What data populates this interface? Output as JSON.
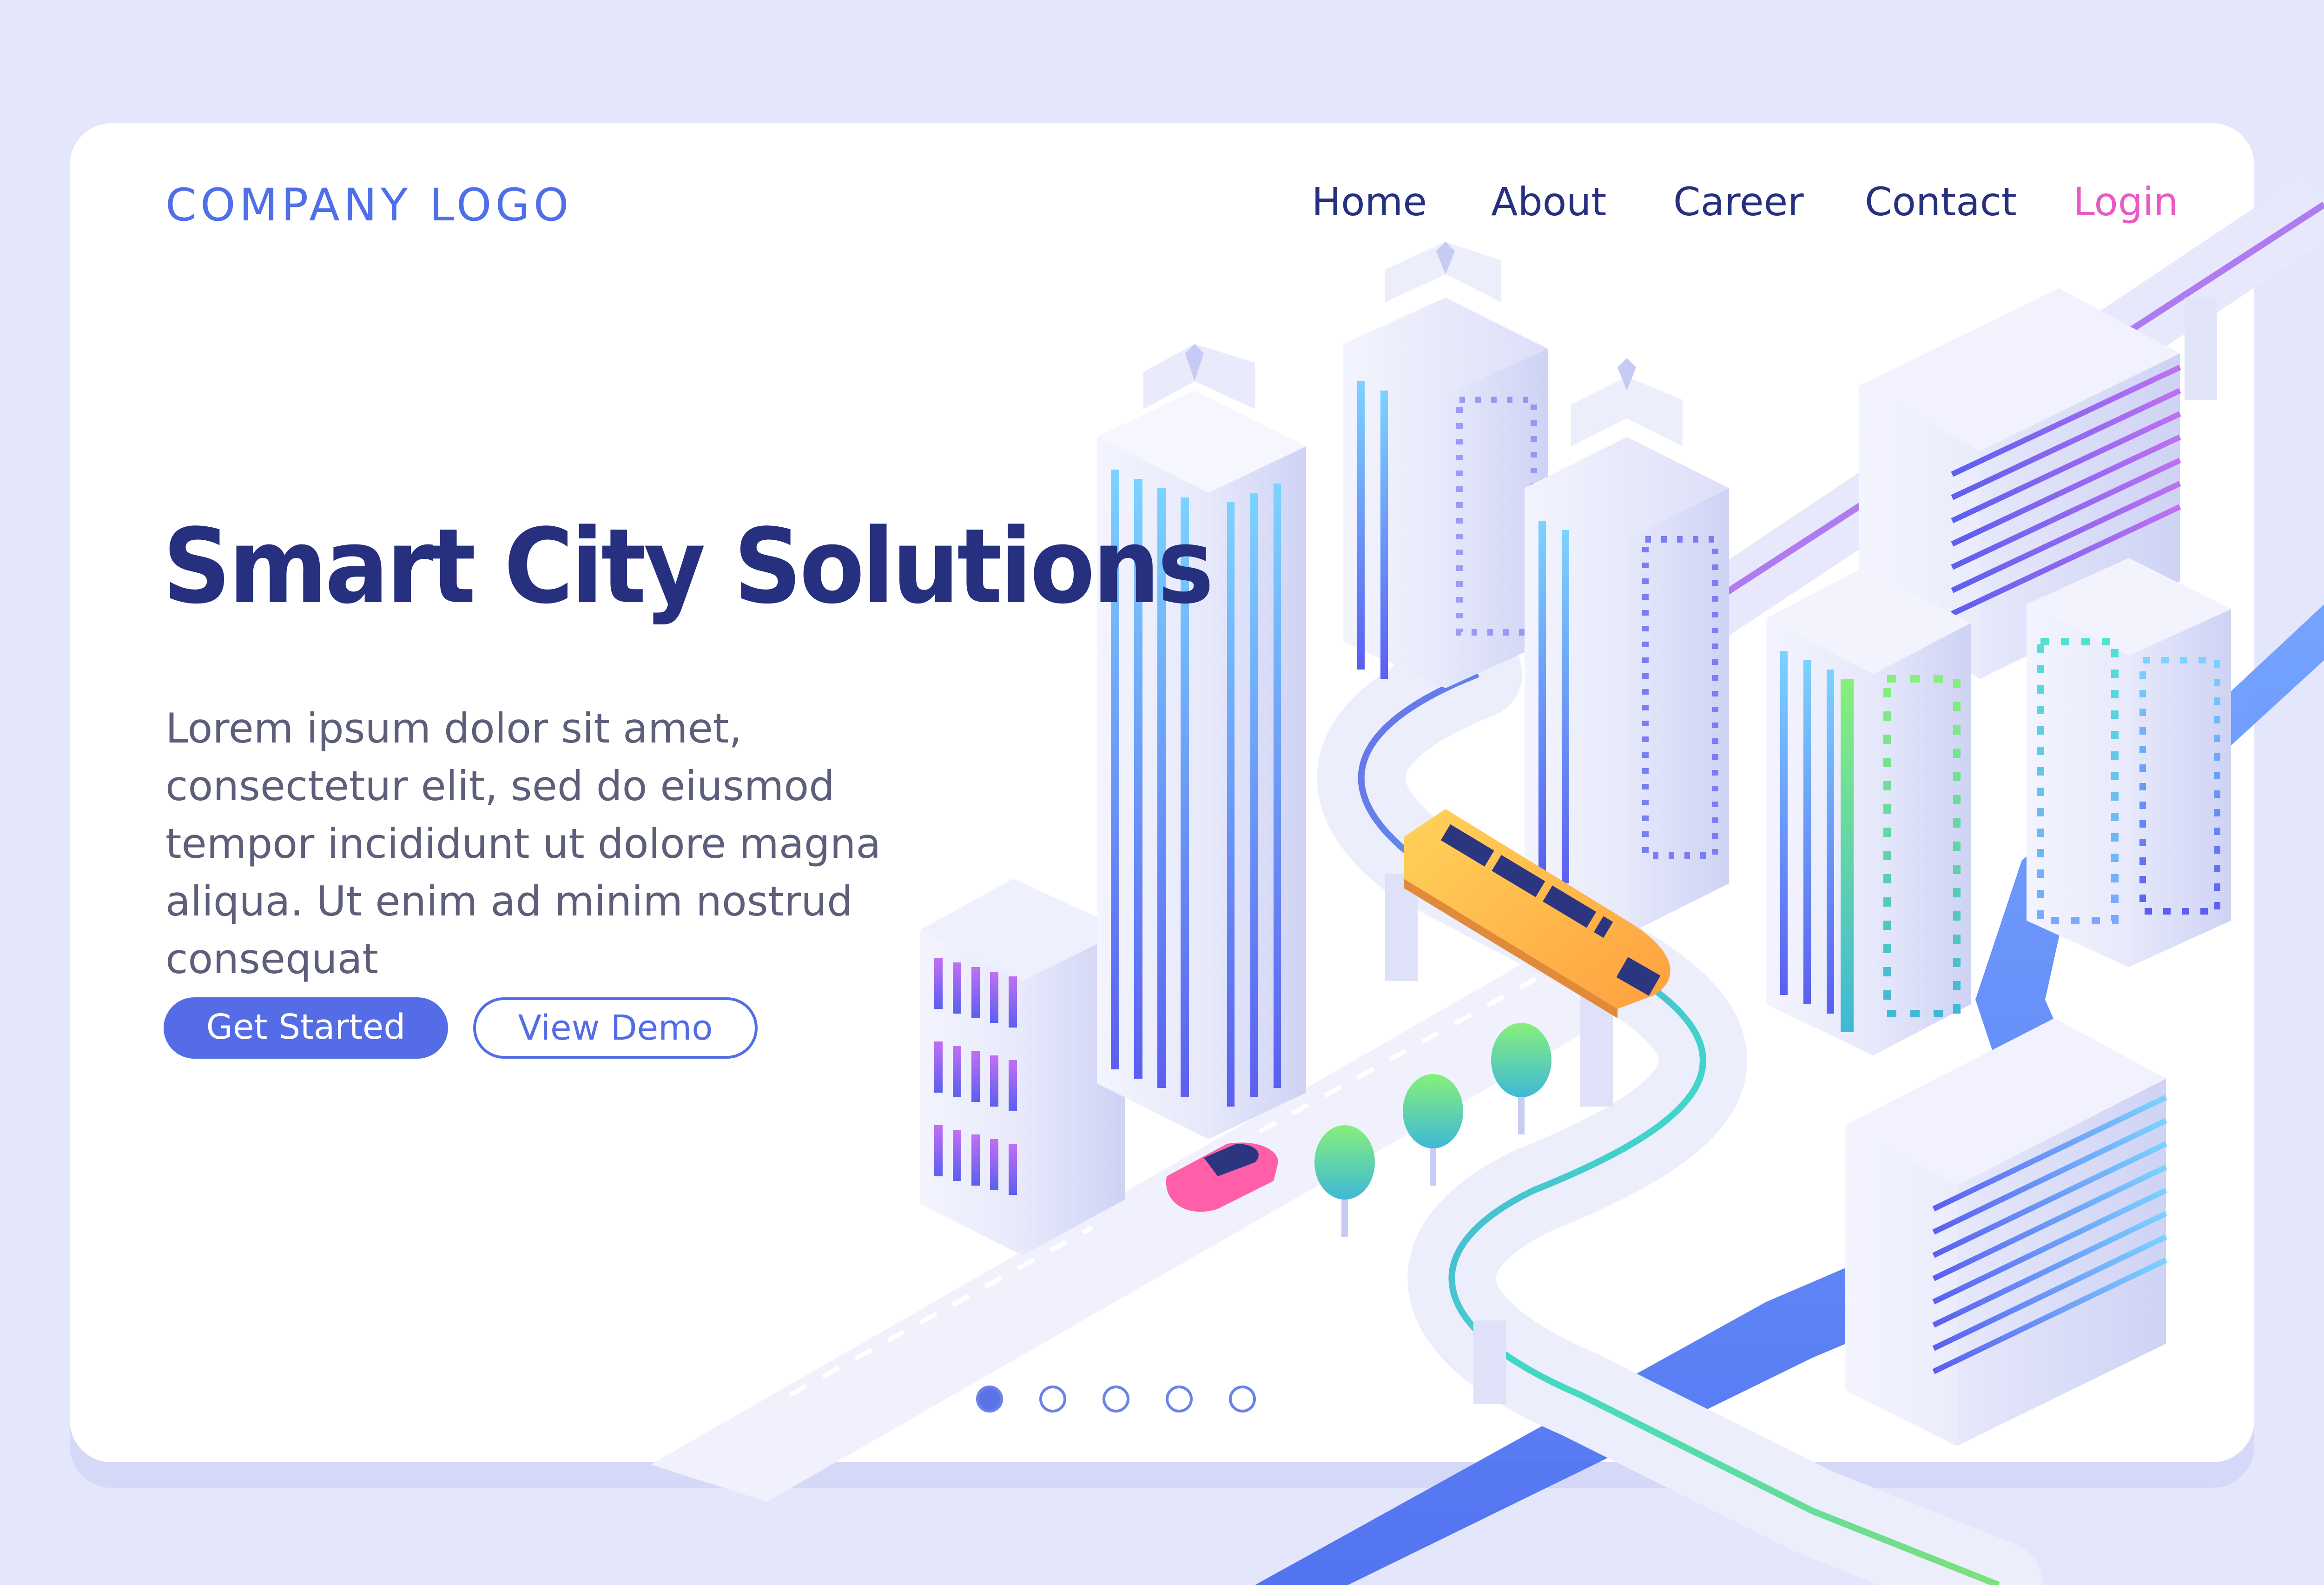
{
  "brand": {
    "logo_text": "COMPANY LOGO"
  },
  "nav": {
    "items": [
      {
        "label": "Home"
      },
      {
        "label": "About"
      },
      {
        "label": "Career"
      },
      {
        "label": "Contact"
      }
    ],
    "login_label": "Login"
  },
  "hero": {
    "title": "Smart City Solutions",
    "description": "Lorem ipsum dolor sit amet, consectetur elit, sed do eiusmod tempor incididunt ut dolore magna aliqua. Ut enim ad minim nostrud consequat",
    "primary_button": "Get Started",
    "secondary_button": "View Demo"
  },
  "pagination": {
    "total": 5,
    "active_index": 0
  },
  "colors": {
    "background": "#e4e6fb",
    "accent": "#546de6",
    "title": "#26307e",
    "login": "#e95ac4"
  },
  "icons": {
    "illustration": "isometric-smart-city-illustration",
    "train": "monorail-train-icon",
    "car": "car-icon",
    "tree": "tree-icon"
  }
}
